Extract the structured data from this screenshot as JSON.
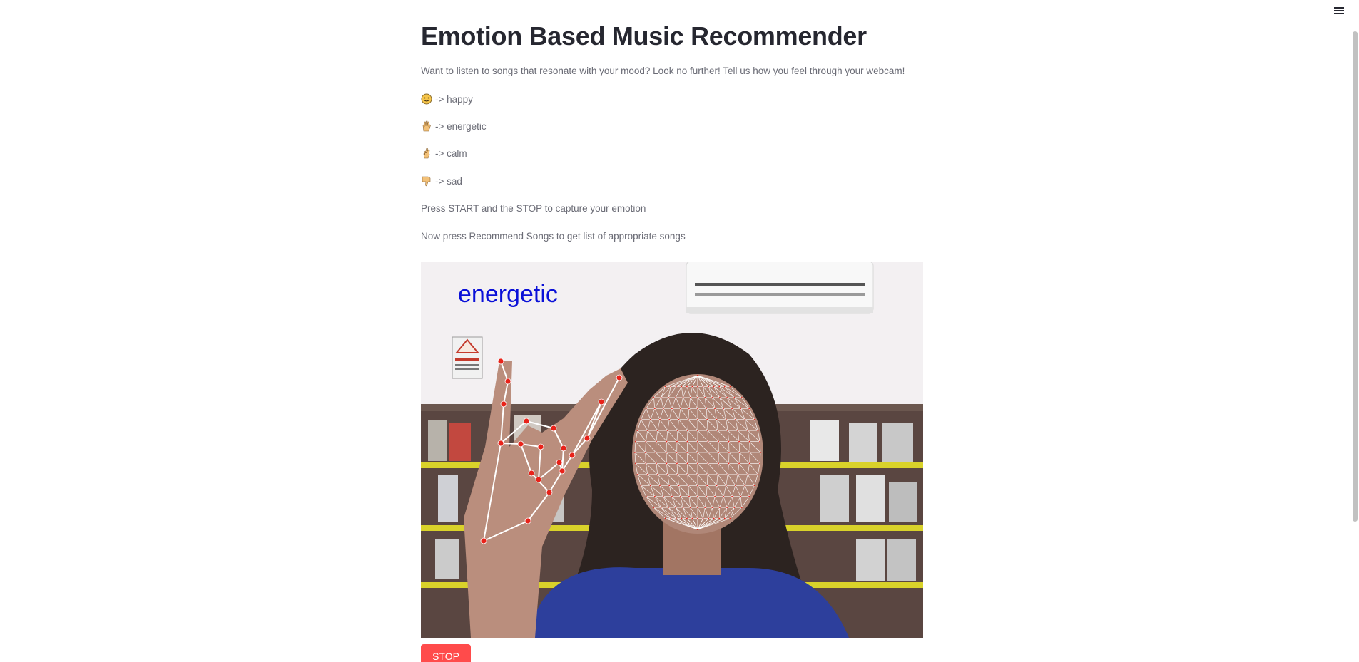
{
  "app": {
    "title": "Emotion Based Music Recommender",
    "menu_icon": "hamburger-menu-icon"
  },
  "intro": "Want to listen to songs that resonate with your mood? Look no further! Tell us how you feel through your webcam!",
  "gestures": [
    {
      "emoji": "smiley-face-icon",
      "label": "-> happy"
    },
    {
      "emoji": "raised-hand-icon",
      "label": "-> energetic"
    },
    {
      "emoji": "ok-hand-icon",
      "label": "-> calm"
    },
    {
      "emoji": "thumbs-down-icon",
      "label": "-> sad"
    }
  ],
  "instructions": {
    "capture": "Press START and the STOP to capture your emotion",
    "recommend": "Now press Recommend Songs to get list of appropriate songs"
  },
  "webcam": {
    "overlay_label": "energetic",
    "overlay_color": "#0a10d8",
    "landmark_color": "#e8231a",
    "mesh_color": "#ffffff"
  },
  "controls": {
    "stop_label": "STOP",
    "stop_color": "#ff4b4b"
  }
}
